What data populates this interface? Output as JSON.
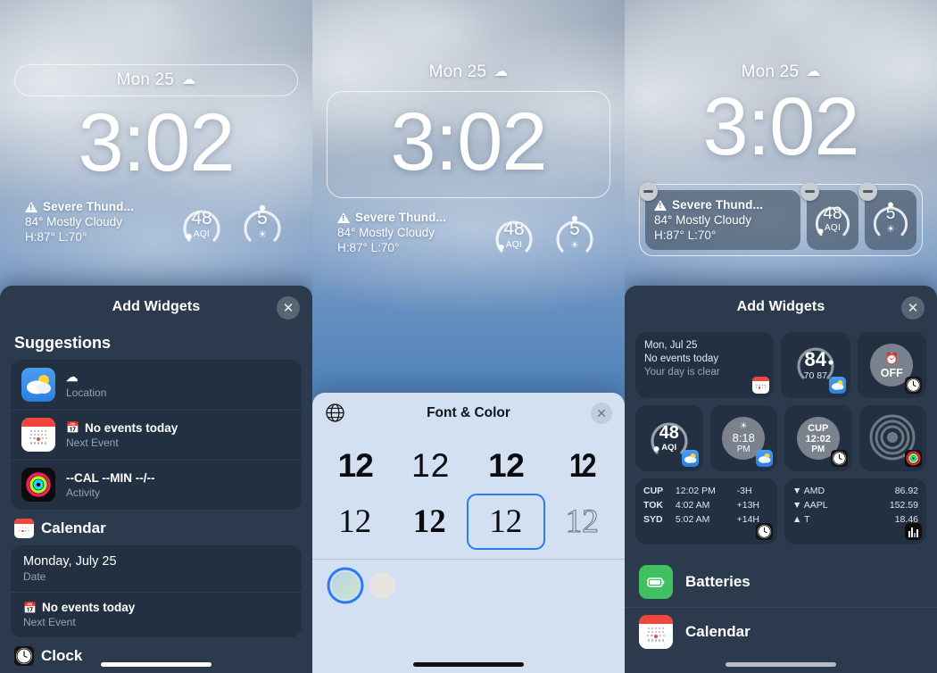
{
  "lockscreen": {
    "date": "Mon 25",
    "weather_icon": "cloud-icon",
    "time": "3:02",
    "weather": {
      "alert": "Severe Thund...",
      "conditions": "84° Mostly Cloudy",
      "highlow": "H:87° L:70°"
    },
    "gauges": [
      {
        "value": "48",
        "label": "AQI",
        "name": "aqi-gauge"
      },
      {
        "value": "5",
        "label": "sun-icon",
        "name": "uv-gauge"
      }
    ]
  },
  "panel1": {
    "sheet": {
      "title": "Add Widgets",
      "close_label": "✕",
      "sections": [
        {
          "heading": "Suggestions",
          "rows": [
            {
              "icon": "weather-app-icon",
              "line1": "",
              "line1_icon": "cloud-icon",
              "line2": "Location"
            },
            {
              "icon": "calendar-app-icon",
              "line1": "No events today",
              "line1_icon": "calendar-glyph-icon",
              "line2": "Next Event"
            },
            {
              "icon": "activity-app-icon",
              "line1": "--CAL --MIN --/--",
              "line2": "Activity"
            }
          ]
        },
        {
          "heading": "Calendar",
          "heading_icon": "calendar-app-icon",
          "rows": [
            {
              "line1": "Monday, July 25",
              "line2": "Date"
            },
            {
              "line1": "No events today",
              "line1_icon": "calendar-glyph-icon",
              "line2": "Next Event"
            }
          ]
        },
        {
          "heading": "Clock",
          "heading_icon": "clock-app-icon",
          "rows": []
        }
      ]
    }
  },
  "panel2": {
    "sheet": {
      "title": "Font & Color",
      "globe_label": "globe-icon",
      "close_label": "✕",
      "font_samples": [
        {
          "text": "12",
          "style": "heavy",
          "selected": false
        },
        {
          "text": "12",
          "style": "light",
          "selected": false
        },
        {
          "text": "12",
          "style": "semibold",
          "selected": false
        },
        {
          "text": "12",
          "style": "condensed",
          "selected": false
        },
        {
          "text": "12",
          "style": "serif",
          "selected": false
        },
        {
          "text": "12",
          "style": "serif-bold",
          "selected": false
        },
        {
          "text": "12",
          "style": "serif-selected",
          "selected": true
        },
        {
          "text": "12",
          "style": "outline",
          "selected": false
        }
      ],
      "colors": [
        {
          "name": "gradient-green-blue",
          "hex": "#c4dcd9",
          "selected": true
        },
        {
          "name": "off-white",
          "hex": "#e6e4e1",
          "selected": false
        }
      ]
    }
  },
  "panel3": {
    "edit_widgets": {
      "remove_label": "−",
      "tiles": [
        "weather-alert-tile",
        "aqi-tile",
        "uv-tile"
      ]
    },
    "sheet": {
      "title": "Add Widgets",
      "close_label": "✕",
      "gallery": [
        {
          "row": [
            {
              "name": "calendar-widget",
              "size": "wide",
              "lines": [
                "Mon, Jul 25",
                "No events today",
                "Your day is clear"
              ],
              "badge": "calendar-app-icon"
            },
            {
              "name": "weather-temp-widget",
              "size": "small",
              "value": "84",
              "sub": "70   87",
              "badge": "weather-app-icon"
            },
            {
              "name": "alarm-widget",
              "size": "small",
              "value": "OFF",
              "glyph": "alarm-icon",
              "badge": "clock-app-icon"
            }
          ]
        },
        {
          "row": [
            {
              "name": "aqi-widget",
              "size": "small",
              "value": "48",
              "label": "AQI",
              "badge": "weather-app-icon"
            },
            {
              "name": "sunset-widget",
              "size": "small",
              "value": "8:18",
              "sub": "PM",
              "glyph": "sunset-icon",
              "badge": "weather-app-icon"
            },
            {
              "name": "world-clock-widget",
              "size": "small",
              "value": "CUP",
              "sub": "12:02",
              "sub2": "PM",
              "badge": "clock-app-icon"
            },
            {
              "name": "activity-rings-widget",
              "size": "small",
              "badge": "activity-app-icon"
            }
          ]
        },
        {
          "row": [
            {
              "name": "world-clock-list-widget",
              "size": "wide",
              "clocks": [
                {
                  "city": "CUP",
                  "time": "12:02 PM",
                  "offset": "-3H"
                },
                {
                  "city": "TOK",
                  "time": "4:02 AM",
                  "offset": "+13H"
                },
                {
                  "city": "SYD",
                  "time": "5:02 AM",
                  "offset": "+14H"
                }
              ],
              "badge": "clock-app-icon"
            },
            {
              "name": "stocks-widget",
              "size": "wide",
              "stocks": [
                {
                  "dir": "▼",
                  "symbol": "AMD",
                  "price": "86.92"
                },
                {
                  "dir": "▼",
                  "symbol": "AAPL",
                  "price": "152.59"
                },
                {
                  "dir": "▲",
                  "symbol": "T",
                  "price": "18.46"
                }
              ],
              "badge": "stocks-app-icon"
            }
          ]
        }
      ],
      "app_list": [
        {
          "icon": "batteries-app-icon",
          "label": "Batteries"
        },
        {
          "icon": "calendar-app-icon",
          "label": "Calendar"
        }
      ]
    }
  }
}
